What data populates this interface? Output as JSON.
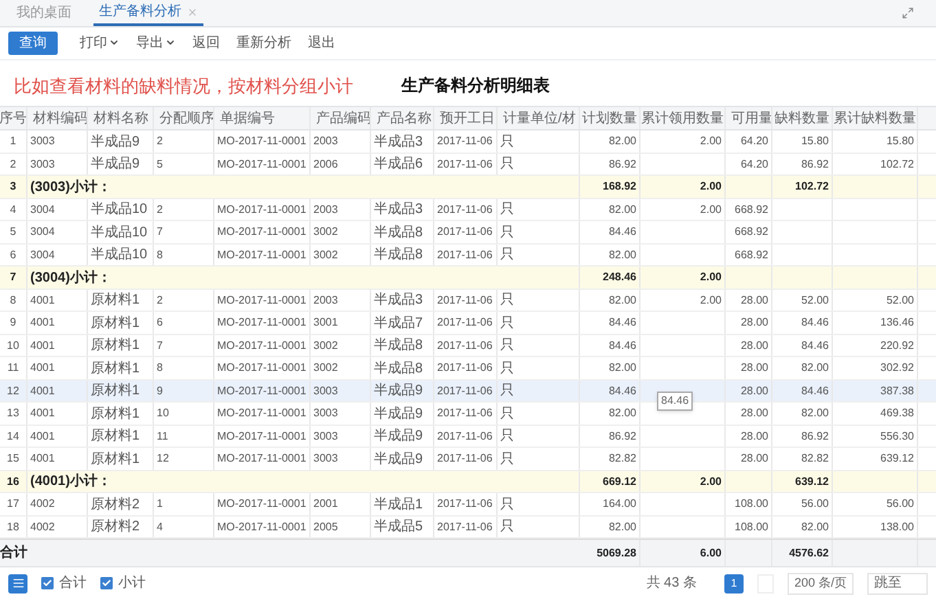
{
  "tabs": [
    {
      "label": "我的桌面",
      "selected": false,
      "closable": false
    },
    {
      "label": "生产备料分析",
      "selected": true,
      "closable": true
    }
  ],
  "toolbar": [
    {
      "label": "查询",
      "kind": "primary"
    },
    {
      "label": "打印",
      "kind": "dropdown"
    },
    {
      "label": "导出",
      "kind": "dropdown"
    },
    {
      "label": "返回",
      "kind": "plain"
    },
    {
      "label": "重新分析",
      "kind": "plain"
    },
    {
      "label": "退出",
      "kind": "plain"
    }
  ],
  "note": "比如查看材料的缺料情况，按材料分组小计",
  "title": "生产备料分析明细表",
  "table": {
    "columns": [
      "序号",
      "材料编码",
      "材料名称",
      "分配顺序",
      "单据编号",
      "产品编码",
      "产品名称",
      "预开工日",
      "计量单位/材",
      "计划数量",
      "累计领用数量",
      "可用量",
      "缺料数量",
      "累计缺料数量"
    ],
    "rows": [
      {
        "kind": "item",
        "selected": false,
        "cells": [
          "1",
          "3003",
          "半成品9",
          "2",
          "MO-2017-11-0001",
          "2003",
          "半成品3",
          "2017-11-06",
          "只",
          "82.00",
          "2.00",
          "64.20",
          "15.80",
          "15.80"
        ]
      },
      {
        "kind": "item",
        "selected": false,
        "cells": [
          "2",
          "3003",
          "半成品9",
          "5",
          "MO-2017-11-0001",
          "2006",
          "半成品6",
          "2017-11-06",
          "只",
          "86.92",
          null,
          "64.20",
          "86.92",
          "102.72"
        ]
      },
      {
        "kind": "subtotal",
        "selected": false,
        "index": "3",
        "label": "(3003)小计：",
        "cells": [
          "168.92",
          "2.00",
          null,
          "102.72",
          null
        ]
      },
      {
        "kind": "item",
        "selected": false,
        "cells": [
          "4",
          "3004",
          "半成品10",
          "2",
          "MO-2017-11-0001",
          "2003",
          "半成品3",
          "2017-11-06",
          "只",
          "82.00",
          "2.00",
          "668.92",
          null,
          null
        ]
      },
      {
        "kind": "item",
        "selected": false,
        "cells": [
          "5",
          "3004",
          "半成品10",
          "7",
          "MO-2017-11-0001",
          "3002",
          "半成品8",
          "2017-11-06",
          "只",
          "84.46",
          null,
          "668.92",
          null,
          null
        ]
      },
      {
        "kind": "item",
        "selected": false,
        "cells": [
          "6",
          "3004",
          "半成品10",
          "8",
          "MO-2017-11-0001",
          "3002",
          "半成品8",
          "2017-11-06",
          "只",
          "82.00",
          null,
          "668.92",
          null,
          null
        ]
      },
      {
        "kind": "subtotal",
        "selected": false,
        "index": "7",
        "label": "(3004)小计：",
        "cells": [
          "248.46",
          "2.00",
          null,
          null,
          null
        ]
      },
      {
        "kind": "item",
        "selected": false,
        "cells": [
          "8",
          "4001",
          "原材料1",
          "2",
          "MO-2017-11-0001",
          "2003",
          "半成品3",
          "2017-11-06",
          "只",
          "82.00",
          "2.00",
          "28.00",
          "52.00",
          "52.00"
        ]
      },
      {
        "kind": "item",
        "selected": false,
        "cells": [
          "9",
          "4001",
          "原材料1",
          "6",
          "MO-2017-11-0001",
          "3001",
          "半成品7",
          "2017-11-06",
          "只",
          "84.46",
          null,
          "28.00",
          "84.46",
          "136.46"
        ]
      },
      {
        "kind": "item",
        "selected": false,
        "cells": [
          "10",
          "4001",
          "原材料1",
          "7",
          "MO-2017-11-0001",
          "3002",
          "半成品8",
          "2017-11-06",
          "只",
          "84.46",
          null,
          "28.00",
          "84.46",
          "220.92"
        ]
      },
      {
        "kind": "item",
        "selected": false,
        "cells": [
          "11",
          "4001",
          "原材料1",
          "8",
          "MO-2017-11-0001",
          "3002",
          "半成品8",
          "2017-11-06",
          "只",
          "82.00",
          null,
          "28.00",
          "82.00",
          "302.92"
        ]
      },
      {
        "kind": "item",
        "selected": true,
        "tooltip": "84.46",
        "cells": [
          "12",
          "4001",
          "原材料1",
          "9",
          "MO-2017-11-0001",
          "3003",
          "半成品9",
          "2017-11-06",
          "只",
          "84.46",
          null,
          "28.00",
          "84.46",
          "387.38"
        ]
      },
      {
        "kind": "item",
        "selected": false,
        "cells": [
          "13",
          "4001",
          "原材料1",
          "10",
          "MO-2017-11-0001",
          "3003",
          "半成品9",
          "2017-11-06",
          "只",
          "82.00",
          null,
          "28.00",
          "82.00",
          "469.38"
        ]
      },
      {
        "kind": "item",
        "selected": false,
        "cells": [
          "14",
          "4001",
          "原材料1",
          "11",
          "MO-2017-11-0001",
          "3003",
          "半成品9",
          "2017-11-06",
          "只",
          "86.92",
          null,
          "28.00",
          "86.92",
          "556.30"
        ]
      },
      {
        "kind": "item",
        "selected": false,
        "cells": [
          "15",
          "4001",
          "原材料1",
          "12",
          "MO-2017-11-0001",
          "3003",
          "半成品9",
          "2017-11-06",
          "只",
          "82.82",
          null,
          "28.00",
          "82.82",
          "639.12"
        ]
      },
      {
        "kind": "subtotal",
        "selected": false,
        "index": "16",
        "label": "(4001)小计：",
        "cells": [
          "669.12",
          "2.00",
          null,
          "639.12",
          null
        ]
      },
      {
        "kind": "item",
        "selected": false,
        "cells": [
          "17",
          "4002",
          "原材料2",
          "1",
          "MO-2017-11-0001",
          "2001",
          "半成品1",
          "2017-11-06",
          "只",
          "164.00",
          null,
          "108.00",
          "56.00",
          "56.00"
        ]
      },
      {
        "kind": "item",
        "selected": false,
        "cells": [
          "18",
          "4002",
          "原材料2",
          "4",
          "MO-2017-11-0001",
          "2005",
          "半成品5",
          "2017-11-06",
          "只",
          "82.00",
          null,
          "108.00",
          "82.00",
          "138.00"
        ]
      }
    ],
    "totals": {
      "label": "合计",
      "cells": [
        "5069.28",
        "6.00",
        null,
        "4576.62",
        null
      ]
    }
  },
  "footer": {
    "options": [
      {
        "label": "合计",
        "checked": true
      },
      {
        "label": "小计",
        "checked": true
      }
    ],
    "count": "共 43 条",
    "pages": [
      {
        "label": "1",
        "selected": true
      }
    ],
    "page_size": "200 条/页",
    "jump_label": "跳至"
  }
}
